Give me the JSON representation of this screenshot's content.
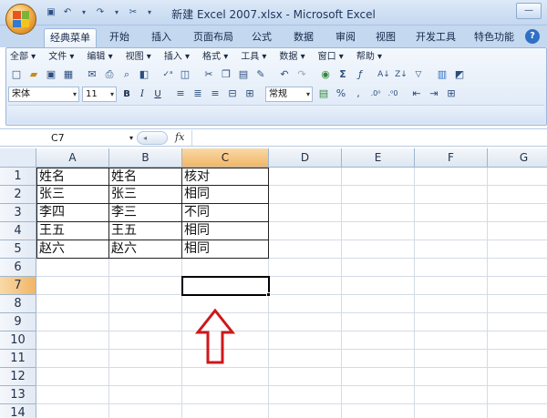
{
  "window": {
    "title": "新建 Excel 2007.xlsx - Microsoft Excel",
    "minimize_glyph": "—"
  },
  "quick_access": [
    "save-icon",
    "undo-icon",
    "redo-icon",
    "customize-icon"
  ],
  "ribbon_tabs": [
    "经典菜单",
    "开始",
    "插入",
    "页面布局",
    "公式",
    "数据",
    "审阅",
    "视图",
    "开发工具",
    "特色功能"
  ],
  "active_tab": "经典菜单",
  "help_label": "?",
  "classic_menu": [
    "全部 ▾",
    "文件 ▾",
    "编辑 ▾",
    "视图 ▾",
    "插入 ▾",
    "格式 ▾",
    "工具 ▾",
    "数据 ▾",
    "窗口 ▾",
    "帮助 ▾"
  ],
  "format_toolbar": {
    "font_name": "宋体",
    "font_size": "11",
    "bold": "B",
    "italic": "I",
    "underline": "U",
    "number_format": "常规",
    "percent": "%",
    "comma": ","
  },
  "formula_bar": {
    "name_box": "C7",
    "fx": "fx",
    "value": ""
  },
  "columns": [
    "A",
    "B",
    "C",
    "D",
    "E",
    "F",
    "G"
  ],
  "selected_column": "C",
  "rows": [
    "1",
    "2",
    "3",
    "4",
    "5",
    "6",
    "7",
    "8",
    "9",
    "10",
    "11",
    "12",
    "13",
    "14"
  ],
  "selected_row": "7",
  "table": [
    [
      "姓名",
      "姓名",
      "核对"
    ],
    [
      "张三",
      "张三",
      "相同"
    ],
    [
      "李四",
      "李三",
      "不同"
    ],
    [
      "王五",
      "王五",
      "相同"
    ],
    [
      "赵六",
      "赵六",
      "相同"
    ]
  ],
  "colors": {
    "accent": "#f1b667",
    "annotation_arrow": "#d0161b",
    "ribbon": "#c4d8f0"
  }
}
